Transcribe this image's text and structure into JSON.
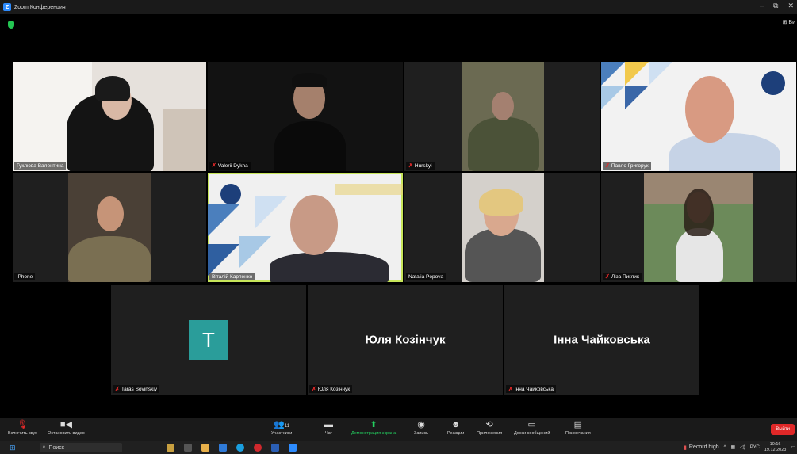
{
  "window": {
    "title": "Zoom Конференция",
    "minimize": "–",
    "restore": "⧉",
    "close": "✕",
    "view_label": "⊞ Ви"
  },
  "participants": {
    "row1": [
      {
        "name": "Гуклюва Валентина",
        "muted": false
      },
      {
        "name": "Valerii Dykha",
        "muted": true
      },
      {
        "name": "Hurskyi",
        "muted": true
      },
      {
        "name": "Павло Григорук",
        "muted": true
      }
    ],
    "row2": [
      {
        "name": "iPhone",
        "muted": false
      },
      {
        "name": "Віталій Карпенко",
        "muted": false,
        "active": true
      },
      {
        "name": "Natalia Popova",
        "muted": false
      },
      {
        "name": "Ліза Пиглик",
        "muted": true
      }
    ],
    "row3": [
      {
        "name": "Taras Sovinskiy",
        "muted": true,
        "avatar_letter": "T"
      },
      {
        "name": "Юля Козінчук",
        "muted": true,
        "display_name": "Юля Козінчук"
      },
      {
        "name": "Інна Чайковська",
        "muted": true,
        "display_name": "Інна Чайковська"
      }
    ]
  },
  "toolbar": {
    "audio": "Включить звук",
    "video": "Остановить видео",
    "participants": "Участники",
    "participants_count": "11",
    "chat": "Чат",
    "share": "Демонстрация экрана",
    "record": "Запись",
    "reactions": "Реакции",
    "apps": "Приложения",
    "whiteboards": "Доски сообщений",
    "notes": "Примечания",
    "leave": "Выйти"
  },
  "taskbar": {
    "search_placeholder": "Поиск",
    "record_high": "Record high",
    "lang": "РУС",
    "time": "10:16",
    "date": "19.12.2023"
  },
  "colors": {
    "accent_green": "#23d160",
    "mute_red": "#e02828",
    "zoom_blue": "#2D8CFF",
    "avatar_teal": "#2a9d9a",
    "active_border": "#c7e55a"
  }
}
